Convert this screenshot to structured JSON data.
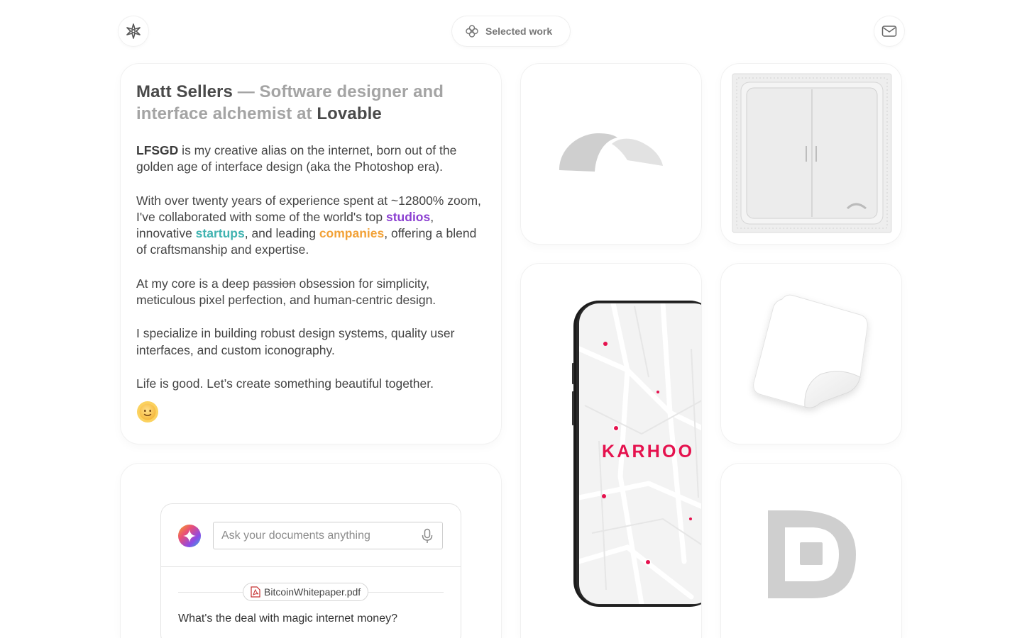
{
  "header": {
    "nav_label": "Selected work",
    "logo_icon": "sparkle-logo-icon",
    "nav_icon": "flower-icon",
    "mail_icon": "mail-icon"
  },
  "bio": {
    "name": "Matt Sellers",
    "title_mid": " — Software designer and interface alchemist at ",
    "brand": "Lovable",
    "p1_bold": "LFSGD",
    "p1_rest": " is my creative alias on the internet, born out of the golden age of interface design (aka the Photoshop era).",
    "p2_a": "With over twenty years of experience spent at ~12800% zoom, I've collaborated with some of the world's top ",
    "p2_studios": "studios",
    "p2_b": ", innovative ",
    "p2_startups": "startups",
    "p2_c": ", and leading ",
    "p2_companies": "companies",
    "p2_d": ", offering a blend of craftsmanship and expertise.",
    "p3_a": "At my core is a deep ",
    "p3_strike": "passion",
    "p3_b": " obsession for simplicity, meticulous pixel perfection, and human-centric design.",
    "p4": "I specialize in building robust design systems, quality user interfaces, and custom iconography.",
    "p5": "Life is good. Let’s create something beautiful together.",
    "emoji_icon": "sun-emoji-icon",
    "colors": {
      "studios": "#8b3fd1",
      "startups": "#3fb3b0",
      "companies": "#f2a136"
    }
  },
  "chat": {
    "placeholder": "Ask your documents anything",
    "file_name": "BitcoinWhitepaper.pdf",
    "question": "What's the deal with magic internet money?",
    "ai_icon": "ai-sparkle-icon",
    "mic_icon": "microphone-icon",
    "pdf_icon": "pdf-file-icon"
  },
  "work": {
    "phone_brand": "KARHOO",
    "brand_color": "#e5124e"
  }
}
